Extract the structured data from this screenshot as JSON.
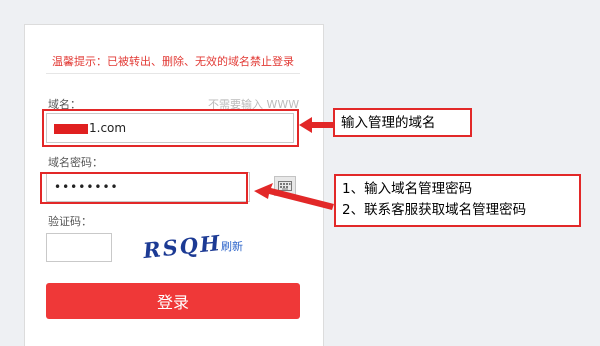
{
  "warning": "温馨提示：已被转出、删除、无效的域名禁止登录",
  "domain": {
    "label": "域名：",
    "hint": "不需要输入 WWW",
    "value_suffix": "1.com"
  },
  "password": {
    "label": "域名密码：",
    "value": "••••••••"
  },
  "captcha": {
    "label": "验证码：",
    "image_text": "RSQH",
    "refresh": "刷新"
  },
  "login_button": "登录",
  "annotations": {
    "note_1": "输入管理的域名",
    "note_2_line1": "1、输入域名管理密码",
    "note_2_line2": "2、联系客服获取域名管理密码"
  },
  "icons": {
    "keyboard": "keyboard-icon"
  },
  "colors": {
    "accent_red": "#ef3838",
    "annotation_red": "#e22828",
    "link_blue": "#2a62c9"
  }
}
